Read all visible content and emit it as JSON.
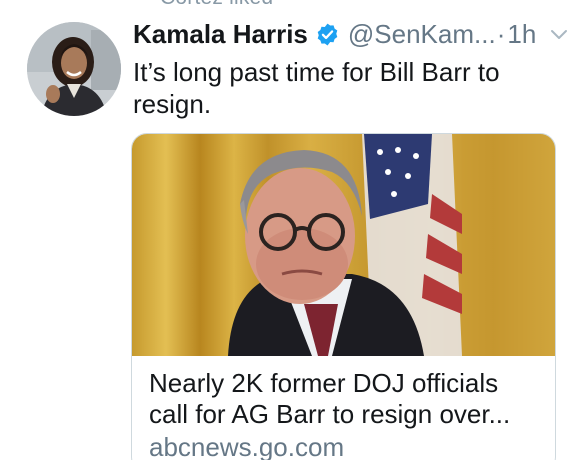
{
  "social_context": "Cortez liked",
  "tweet": {
    "author_name": "Kamala Harris",
    "author_handle": "@SenKam...",
    "separator": "·",
    "timestamp": "1h",
    "text_line1": "It’s long past time for Bill Barr to",
    "text_line2": "resign."
  },
  "card": {
    "title_line1": "Nearly 2K former DOJ officials",
    "title_line2": "call for AG Barr to resign over...",
    "domain": "abcnews.go.com"
  },
  "colors": {
    "verified_badge": "#1da1f2",
    "secondary_text": "#657786",
    "primary_text": "#14171a"
  },
  "icons": {
    "verified": "verified-badge-icon",
    "more": "chevron-down-icon"
  }
}
